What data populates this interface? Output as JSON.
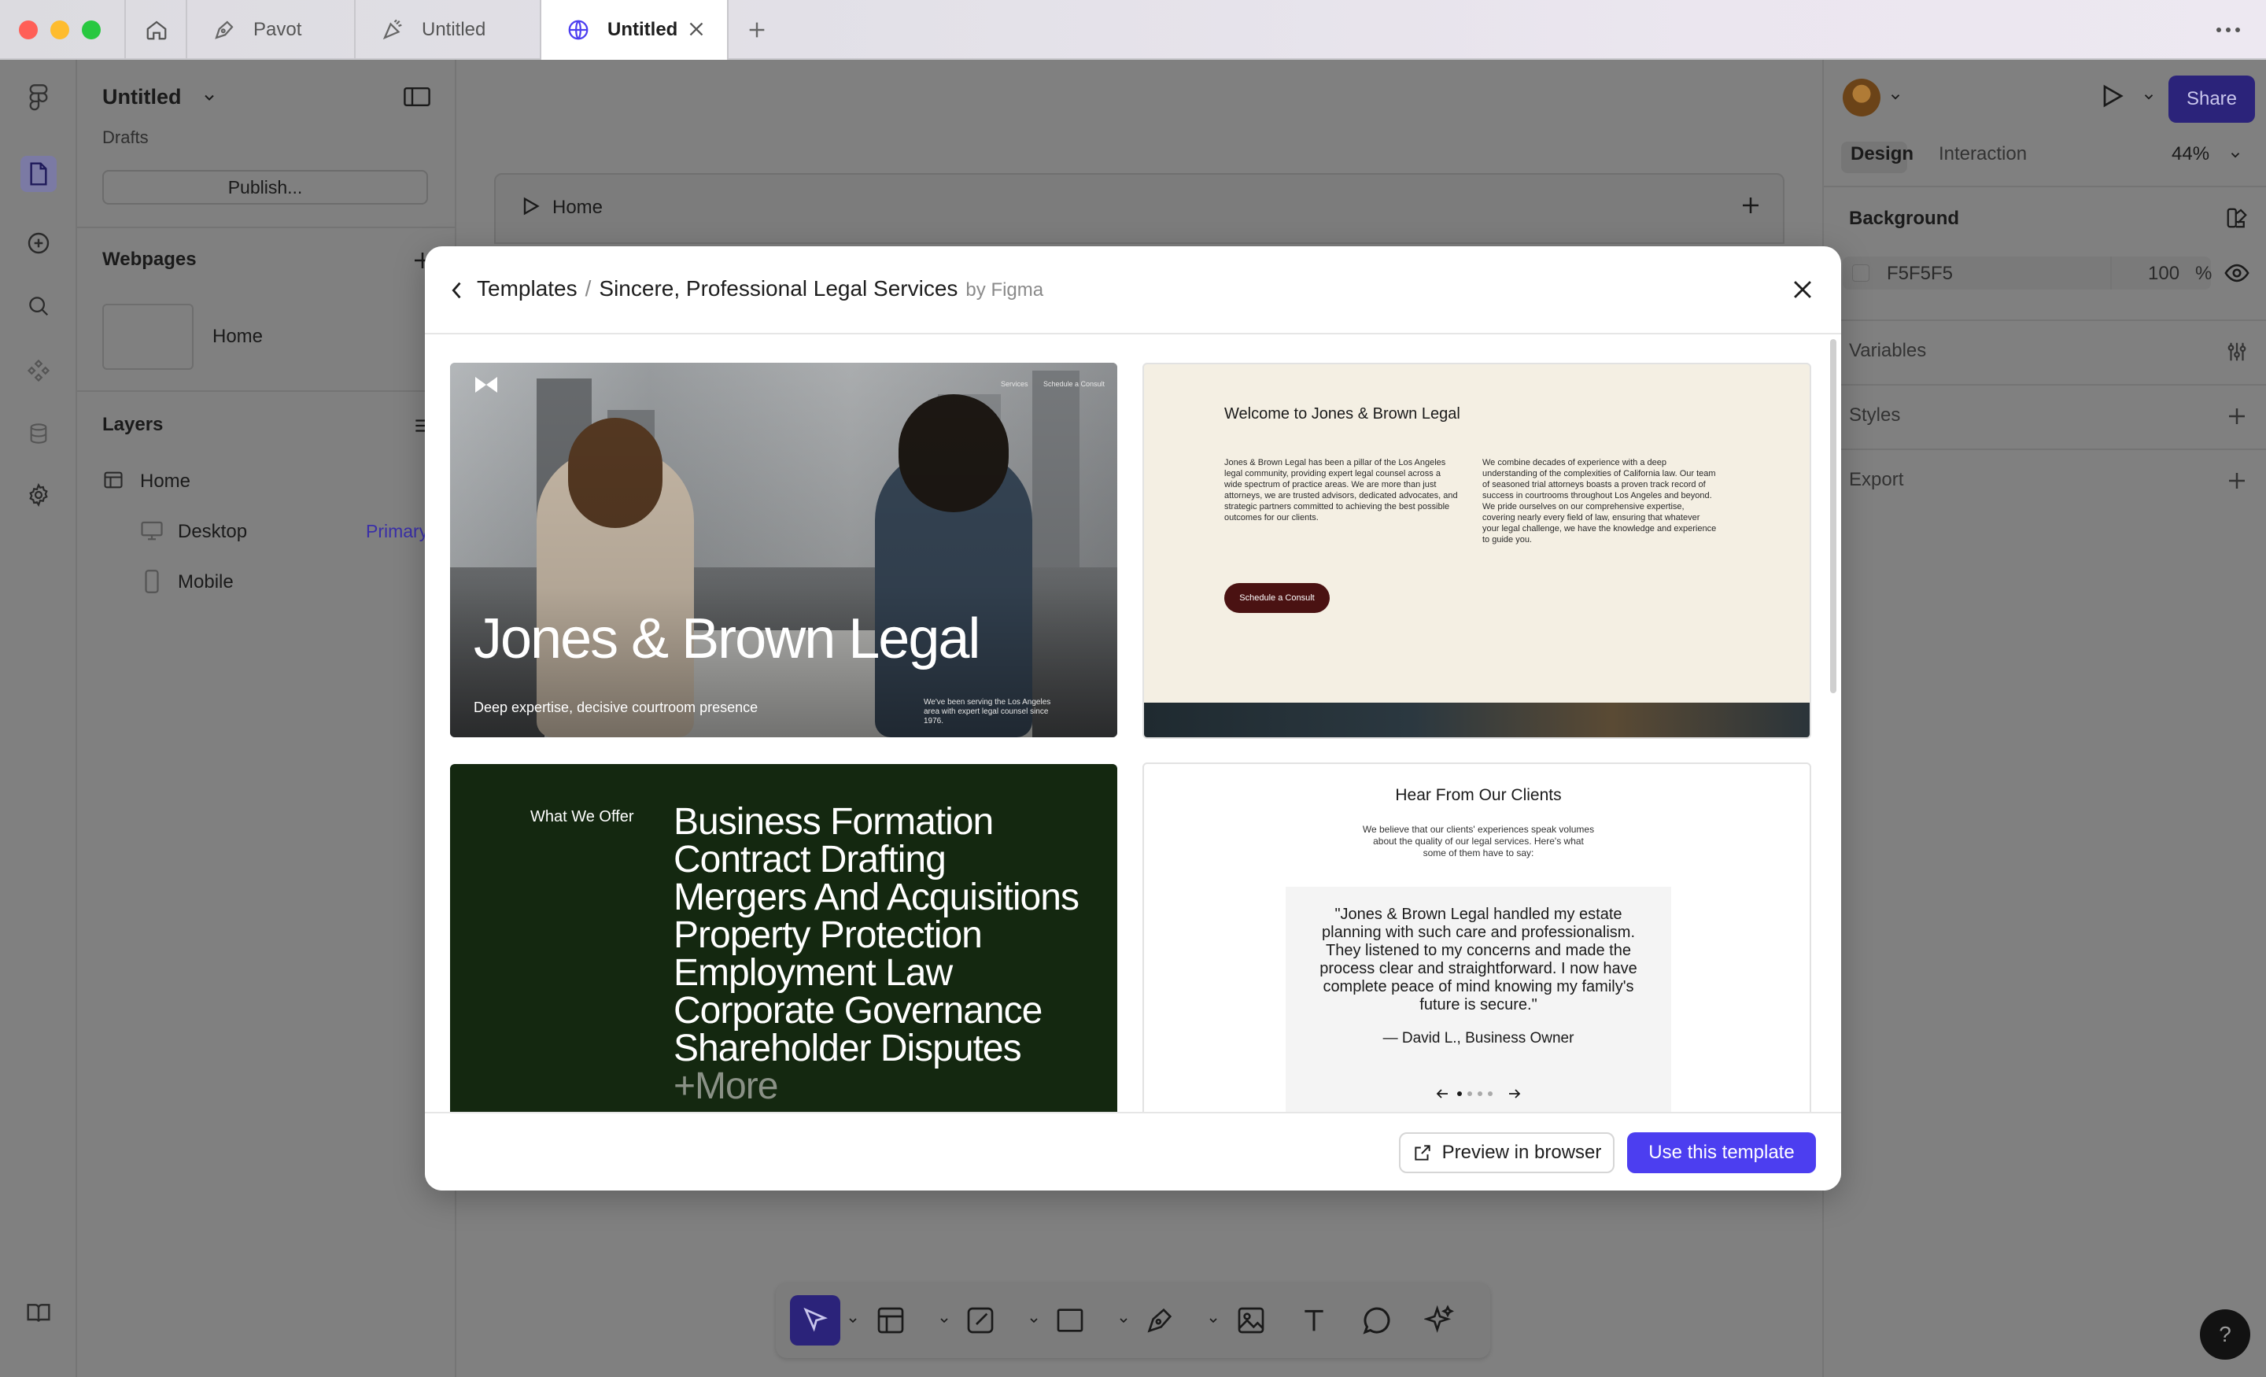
{
  "tabs": [
    {
      "label": "Pavot"
    },
    {
      "label": "Untitled"
    },
    {
      "label": "Untitled"
    }
  ],
  "left_panel": {
    "file_name": "Untitled",
    "location": "Drafts",
    "publish_label": "Publish...",
    "webpages_title": "Webpages",
    "webpage_name": "Home",
    "layers_title": "Layers",
    "layers": [
      {
        "label": "Home"
      },
      {
        "label": "Desktop",
        "badge": "Primary"
      },
      {
        "label": "Mobile"
      }
    ]
  },
  "canvas": {
    "page_label": "Home"
  },
  "right_panel": {
    "tab_design": "Design",
    "tab_interaction": "Interaction",
    "zoom": "44%",
    "share_label": "Share",
    "background_title": "Background",
    "bg_hex": "F5F5F5",
    "bg_opacity": "100",
    "bg_opacity_unit": "%",
    "variables": "Variables",
    "styles": "Styles",
    "export": "Export"
  },
  "modal": {
    "breadcrumb_root": "Templates",
    "separator": "/",
    "template_name": "Sincere, Professional Legal Services",
    "byline": "by Figma",
    "preview_label": "Preview in browser",
    "use_label": "Use this template",
    "accent": "#4c3ef0",
    "cards": {
      "hero": {
        "title": "Jones & Brown Legal",
        "tagline": "Deep expertise, decisive courtroom presence",
        "nav1": "Services",
        "nav2": "Schedule a Consult",
        "note": "We've been serving the Los Angeles area with expert legal counsel since 1976."
      },
      "welcome": {
        "heading": "Welcome to Jones & Brown Legal",
        "col1": "Jones & Brown Legal has been a pillar of the Los Angeles legal community, providing expert legal counsel across a wide spectrum of practice areas. We are more than just attorneys, we are trusted advisors, dedicated advocates, and strategic partners committed to achieving the best possible outcomes for our clients.",
        "col2": "We combine decades of experience with a deep understanding of the complexities of California law. Our team of seasoned trial attorneys boasts a proven track record of success in courtrooms throughout Los Angeles and beyond. We pride ourselves on our comprehensive expertise, covering nearly every field of law, ensuring that whatever your legal challenge, we have the knowledge and experience to guide you.",
        "cta": "Schedule a Consult"
      },
      "offer": {
        "label": "What We Offer",
        "items": [
          "Business Formation",
          "Contract Drafting",
          "Mergers And Acquisitions",
          "Property Protection",
          "Employment Law",
          "Corporate Governance",
          "Shareholder Disputes",
          "+More"
        ]
      },
      "clients": {
        "heading": "Hear From Our Clients",
        "sub": "We believe that our clients' experiences speak volumes about the quality of our legal services. Here's what some of them have to say:",
        "quote": "\"Jones & Brown Legal handled my estate planning with such care and professionalism. They listened to my concerns and made the process clear and straightforward. I now have complete peace of mind knowing my family's future is secure.\"",
        "author": "— David L., Business Owner"
      }
    }
  }
}
